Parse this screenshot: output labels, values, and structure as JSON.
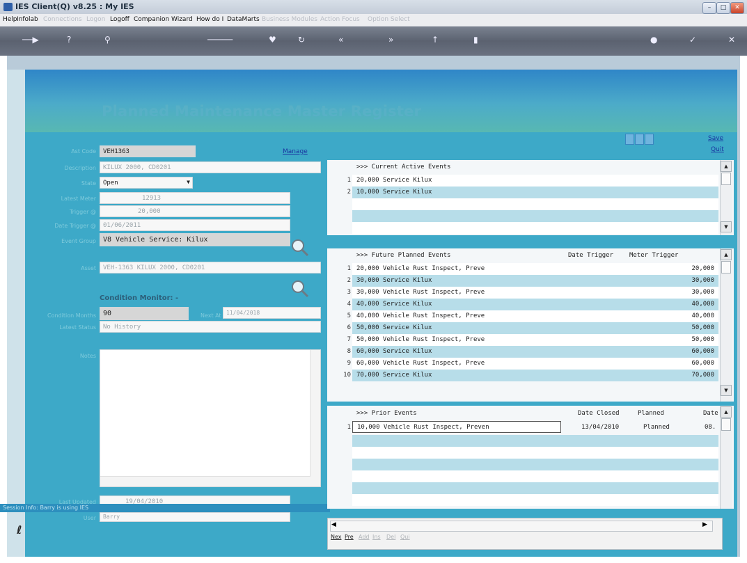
{
  "window": {
    "title": "IES Client(Q) v8.25 : My IES",
    "minimize_icon": "minimize-icon",
    "maximize_icon": "maximize-icon",
    "close_icon": "close-icon"
  },
  "menu": [
    {
      "label": "Help",
      "enabled": true
    },
    {
      "label": "Infolab",
      "enabled": true
    },
    {
      "label": "Connections",
      "enabled": false
    },
    {
      "label": "Logon",
      "enabled": false
    },
    {
      "label": "Logoff",
      "enabled": true
    },
    {
      "label": "Companion",
      "enabled": true
    },
    {
      "label": "Wizard",
      "enabled": true
    },
    {
      "label": "How do I",
      "enabled": true
    },
    {
      "label": "DataMarts",
      "enabled": true
    },
    {
      "label": "Business Modules",
      "enabled": false
    },
    {
      "label": "Action Focus",
      "enabled": false
    },
    {
      "label": "Option Select",
      "enabled": false
    }
  ],
  "page": {
    "title": "Planned Maintenance Master Register"
  },
  "links": {
    "manage": "Manage",
    "save": "Save",
    "quit": "Quit"
  },
  "form": {
    "asset_code_label": "Ast Code",
    "asset_code": "VEH1363",
    "description_label": "Description",
    "description": "KILUX 2000, CD0201",
    "state_label": "State",
    "state": "Open",
    "latest_meter_label": "Latest Meter",
    "latest_meter": "12913",
    "trigger_label": "Trigger @",
    "trigger": "20,000",
    "date_trigger_label": "Date Trigger @",
    "date_trigger": "01/06/2011",
    "event_group_label": "Event Group",
    "event_group": "V8 Vehicle Service: Kilux",
    "asset_label": "Asset",
    "asset": "VEH-1363 KILUX 2000, CD0201",
    "condition_monitor_title": "Condition Monitor: -",
    "condition_months_label": "Condition Months",
    "condition_months": "90",
    "next_at_label": "Next At",
    "next_at": "11/04/2018",
    "latest_status_label": "Latest Status",
    "latest_status": "No History",
    "notes_label": "Notes",
    "last_updated_label": "Last Updated",
    "last_updated": "19/04/2010",
    "user_label": "User",
    "user": "Barry"
  },
  "current_events": {
    "header": ">>> Current Active Events",
    "rows": [
      {
        "n": "1",
        "text": "20,000 Service Kilux"
      },
      {
        "n": "2",
        "text": "10,000 Service Kilux"
      }
    ]
  },
  "future_events": {
    "header": ">>> Future Planned Events",
    "col_date": "Date Trigger",
    "col_meter": "Meter Trigger",
    "rows": [
      {
        "n": "1",
        "text": "20,000 Vehicle Rust Inspect, Preve",
        "meter": "20,000"
      },
      {
        "n": "2",
        "text": "30,000 Service Kilux",
        "meter": "30,000"
      },
      {
        "n": "3",
        "text": "30,000 Vehicle Rust Inspect, Preve",
        "meter": "30,000"
      },
      {
        "n": "4",
        "text": "40,000 Service Kilux",
        "meter": "40,000"
      },
      {
        "n": "5",
        "text": "40,000 Vehicle Rust Inspect, Preve",
        "meter": "40,000"
      },
      {
        "n": "6",
        "text": "50,000 Service Kilux",
        "meter": "50,000"
      },
      {
        "n": "7",
        "text": "50,000 Vehicle Rust Inspect, Preve",
        "meter": "50,000"
      },
      {
        "n": "8",
        "text": "60,000 Service Kilux",
        "meter": "60,000"
      },
      {
        "n": "9",
        "text": "60,000 Vehicle Rust Inspect, Preve",
        "meter": "60,000"
      },
      {
        "n": "10",
        "text": "70,000 Service Kilux",
        "meter": "70,000"
      }
    ]
  },
  "prior_events": {
    "header": ">>> Prior Events",
    "col_closed": "Date Closed",
    "col_planned": "Planned",
    "col_date": "Date",
    "rows": [
      {
        "n": "1",
        "text": "10,000 Vehicle Rust Inspect, Preven",
        "closed": "13/04/2010",
        "planned": "Planned",
        "date": "08."
      }
    ]
  },
  "statusbar": {
    "text": "Session Info: Barry is using IES"
  },
  "nav": {
    "next": "Nex",
    "prev": "Pre",
    "add": "Add",
    "ins": "Ins",
    "del": "Del",
    "quit": "Qui"
  }
}
